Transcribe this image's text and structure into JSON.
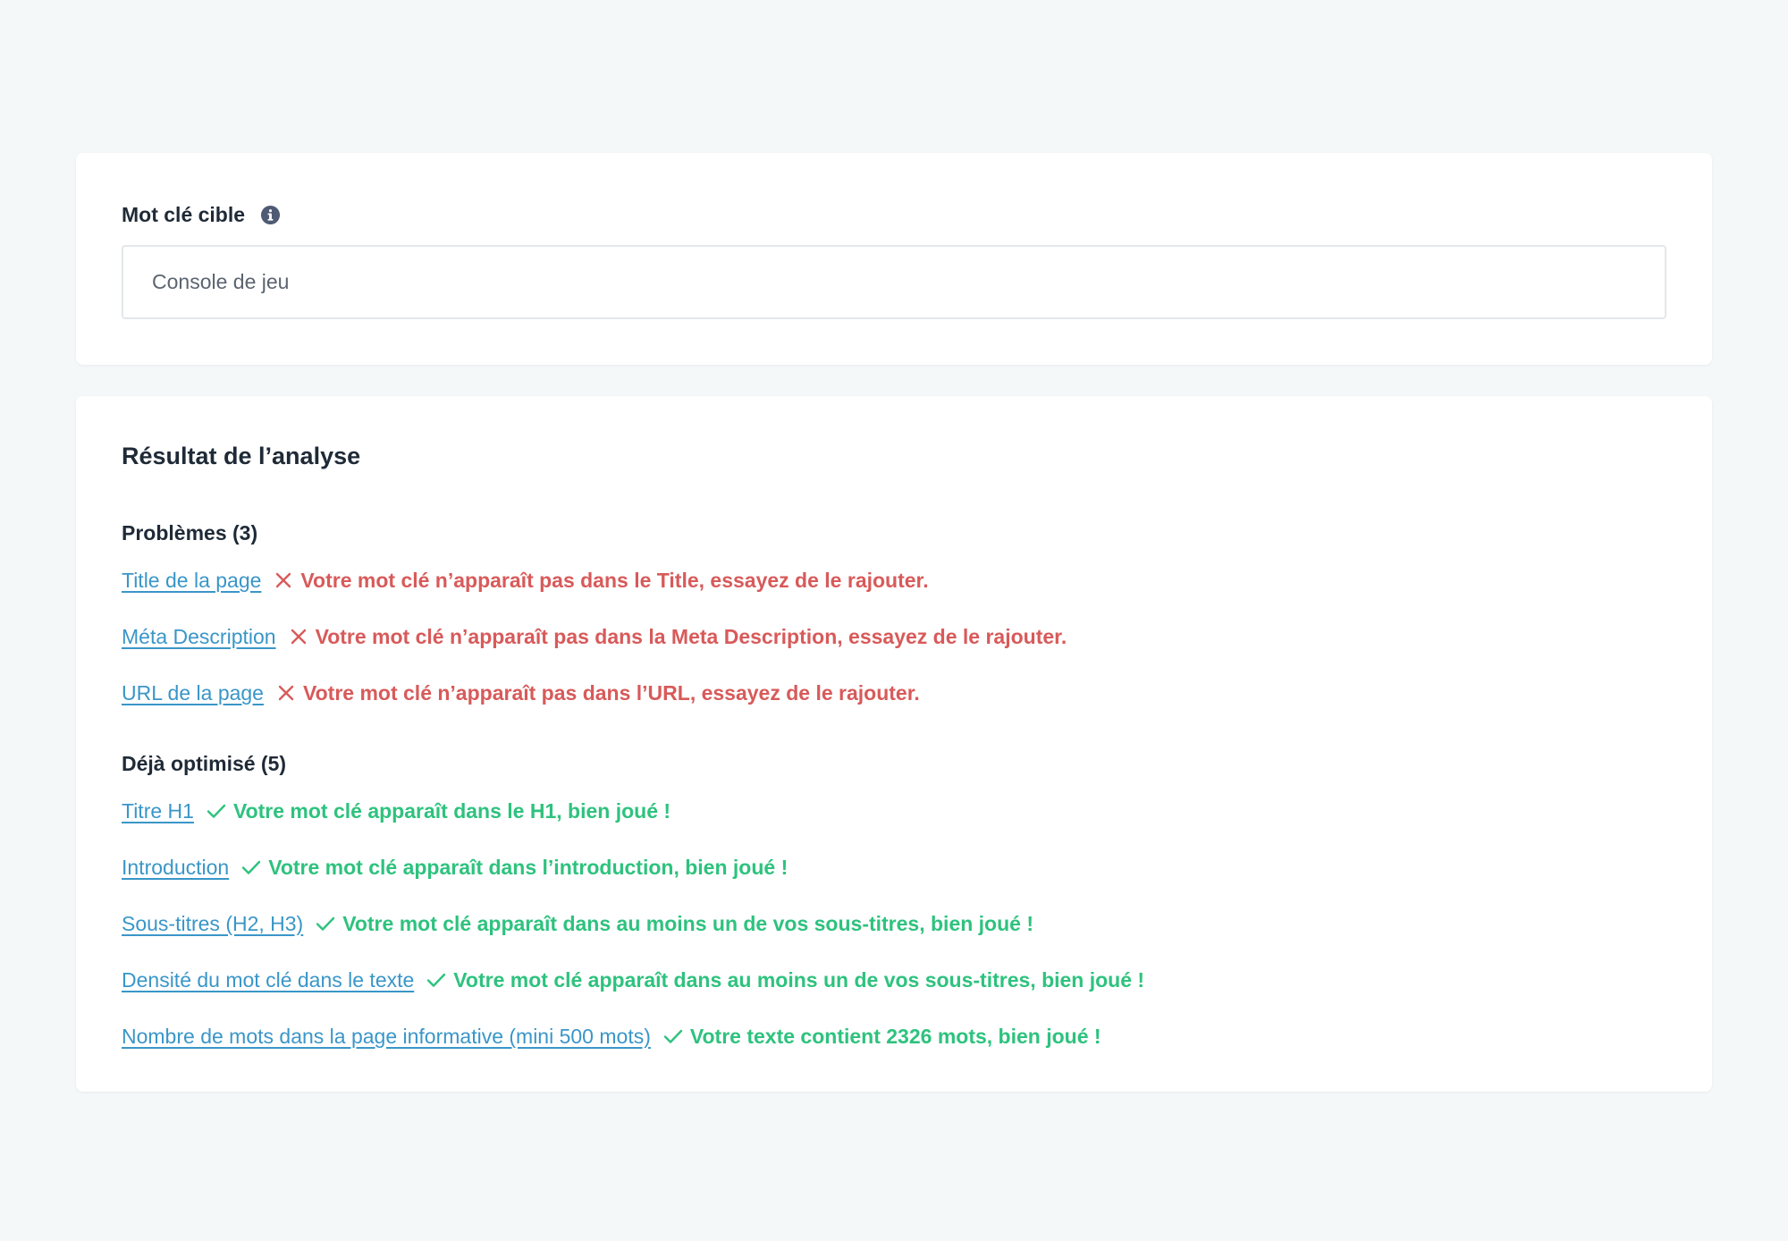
{
  "keyword": {
    "label": "Mot clé cible",
    "value": "Console de jeu",
    "info_icon": "info-circle-icon"
  },
  "results": {
    "title": "Résultat de l’analyse",
    "problems": {
      "title": "Problèmes (3)",
      "items": [
        {
          "link": "Title de la page",
          "message": "Votre mot clé n’apparaît pas dans le Title, essayez de le rajouter."
        },
        {
          "link": "Méta Description",
          "message": "Votre mot clé n’apparaît pas dans la Meta Description, essayez de le rajouter."
        },
        {
          "link": "URL de la page",
          "message": "Votre mot clé n’apparaît pas dans l’URL, essayez de le rajouter."
        }
      ]
    },
    "optimized": {
      "title": "Déjà optimisé (5)",
      "items": [
        {
          "link": "Titre H1",
          "message": "Votre mot clé apparaît dans le H1, bien joué !"
        },
        {
          "link": "Introduction",
          "message": "Votre mot clé apparaît dans l’introduction, bien joué !"
        },
        {
          "link": "Sous-titres (H2, H3)",
          "message": "Votre mot clé apparaît dans au moins un de vos sous-titres, bien joué !"
        },
        {
          "link": "Densité du mot clé dans le texte",
          "message": "Votre mot clé apparaît dans au moins un de vos sous-titres, bien joué !"
        },
        {
          "link": "Nombre de mots dans la page informative (mini 500 mots)",
          "message": "Votre texte contient 2326 mots, bien joué !"
        }
      ]
    }
  },
  "colors": {
    "background": "#f5f8f9",
    "link": "#3a96c8",
    "error": "#d85a5a",
    "success": "#2ec27e",
    "text": "#1f2a37"
  }
}
